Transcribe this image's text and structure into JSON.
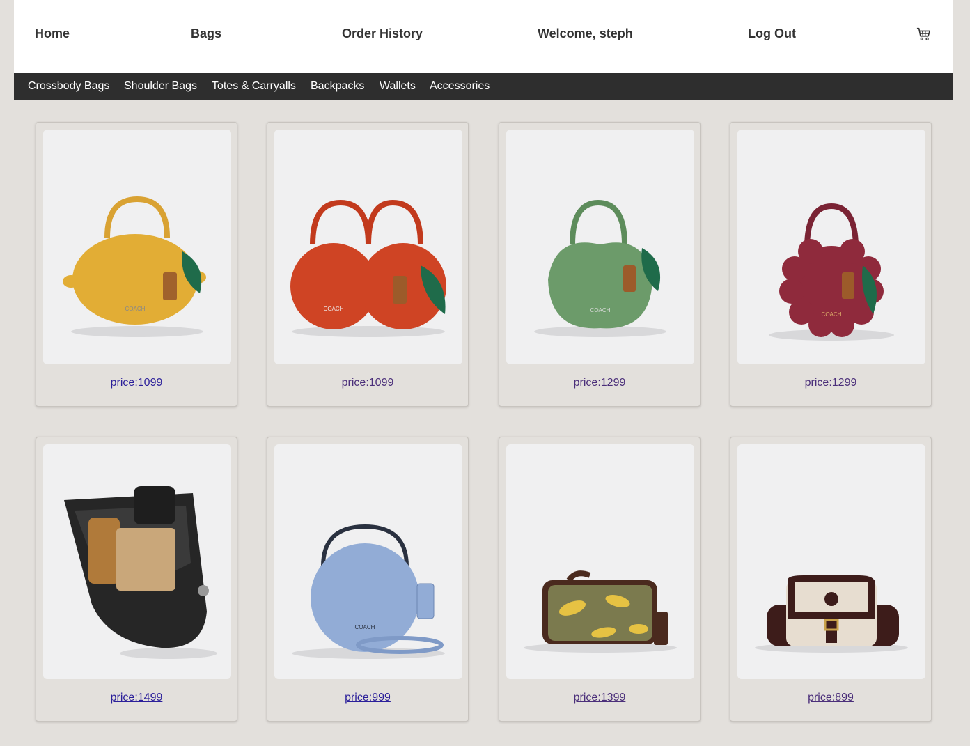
{
  "nav": {
    "home": "Home",
    "bags": "Bags",
    "order_history": "Order History",
    "welcome": "Welcome, steph",
    "logout": "Log Out",
    "cart_icon": "shopping-cart-icon"
  },
  "categories": [
    "Crossbody Bags",
    "Shoulder Bags",
    "Totes & Carryalls",
    "Backpacks",
    "Wallets",
    "Accessories"
  ],
  "products": [
    {
      "price": "price:1099",
      "color": "#e2ad35",
      "shape": "lemon"
    },
    {
      "price": "price:1099",
      "color": "#cf4424",
      "shape": "cherries"
    },
    {
      "price": "price:1299",
      "color": "#6c9b6a",
      "shape": "apple"
    },
    {
      "price": "price:1299",
      "color": "#8f2a3c",
      "shape": "scalloped"
    },
    {
      "price": "price:1499",
      "color": "#262626",
      "shape": "bucket"
    },
    {
      "price": "price:999",
      "color": "#92acd6",
      "shape": "round"
    },
    {
      "price": "price:1399",
      "color": "#7b7a4e",
      "shape": "camera"
    },
    {
      "price": "price:899",
      "color": "#e7ddd0",
      "shape": "saddle"
    }
  ],
  "colors": {
    "page_bg": "#e3e0dc",
    "nav_bg": "#ffffff",
    "category_bar_bg": "#2e2e2e",
    "link": "#2b1f9a"
  }
}
